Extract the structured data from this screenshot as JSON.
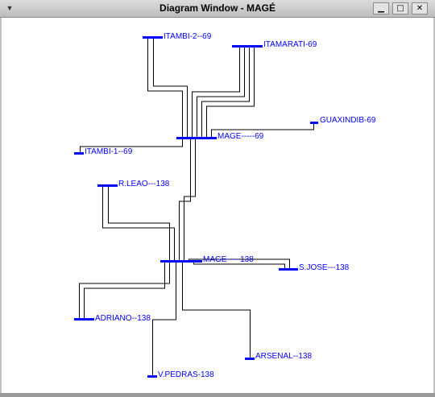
{
  "window": {
    "title": "Diagram Window - MAGÉ",
    "system_menu_icon": "down-triangle-icon",
    "minimize_icon": "minimize-icon",
    "maximize_icon": "maximize-icon",
    "close_icon": "close-icon"
  },
  "colors": {
    "bus": "#0000ff",
    "line": "#000000",
    "label": "#0000ff",
    "canvas": "#ffffff"
  },
  "buses": {
    "itambi_2_69": "ITAMBI-2--69",
    "itamarati_69": "ITAMARATI-69",
    "guaxindib_69": "GUAXINDIB-69",
    "mage_69": "MAGE-----69",
    "itambi_1_69": "ITAMBI-1--69",
    "r_leao_138": "R.LEAO---138",
    "mage_138": "MAGE-----138",
    "s_jose_138": "S.JOSE---138",
    "adriano_138": "ADRIANO--138",
    "arsenal_138": "ARSENAL--138",
    "v_pedras_138": "V.PEDRAS-138"
  }
}
